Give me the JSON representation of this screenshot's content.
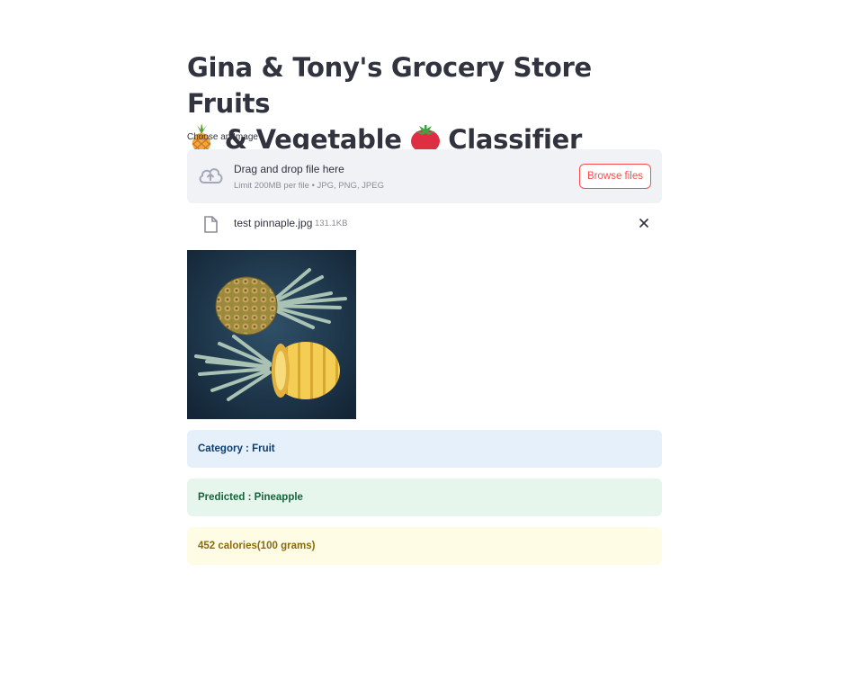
{
  "title": {
    "part1": "Gina & Tony's Grocery Store Fruits",
    "part2": "& Vegetable",
    "part3": "Classifier",
    "icon1": "pineapple-icon",
    "icon2": "tomato-icon"
  },
  "uploader": {
    "label": "Choose an Image",
    "drop_text": "Drag and drop file here",
    "limit_text": "Limit 200MB per file • JPG, PNG, JPEG",
    "browse_label": "Browse files",
    "accent_color": "#ff4b4b"
  },
  "file": {
    "name": "test pinnaple.jpg",
    "size": "131.1KB"
  },
  "results": {
    "category": "Category : Fruit",
    "predicted": "Predicted : Pineapple",
    "calories": "452 calories(100 grams)"
  }
}
